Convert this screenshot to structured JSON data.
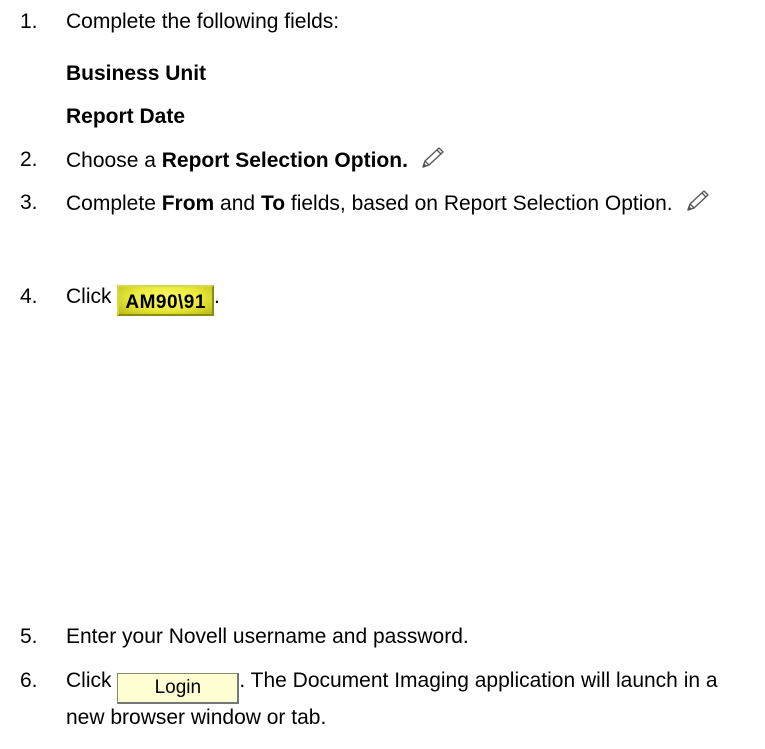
{
  "steps": [
    {
      "number": "1.",
      "text": "Complete the following fields:",
      "fields": [
        "Business Unit",
        "Report Date"
      ]
    },
    {
      "number": "2.",
      "prefix": "Choose a ",
      "bold": "Report Selection Option.",
      "icon": "pencil-icon"
    },
    {
      "number": "3.",
      "prefix": "Complete ",
      "bold_from": "From",
      "mid": " and ",
      "bold_to": "To",
      "suffix": " fields, based on Report Selection Option.",
      "icon": "pencil-icon"
    },
    {
      "number": "4.",
      "prefix": "Click ",
      "button_label": "AM90\\91",
      "suffix": "."
    },
    {
      "number": "5.",
      "text": "Enter your Novell username and password."
    },
    {
      "number": "6.",
      "prefix": "Click ",
      "button_label": "Login",
      "suffix": ". The Document Imaging application will launch in a new browser window or tab."
    }
  ],
  "colors": {
    "am_button": "#e8e83a",
    "login_button": "#fefed2"
  }
}
